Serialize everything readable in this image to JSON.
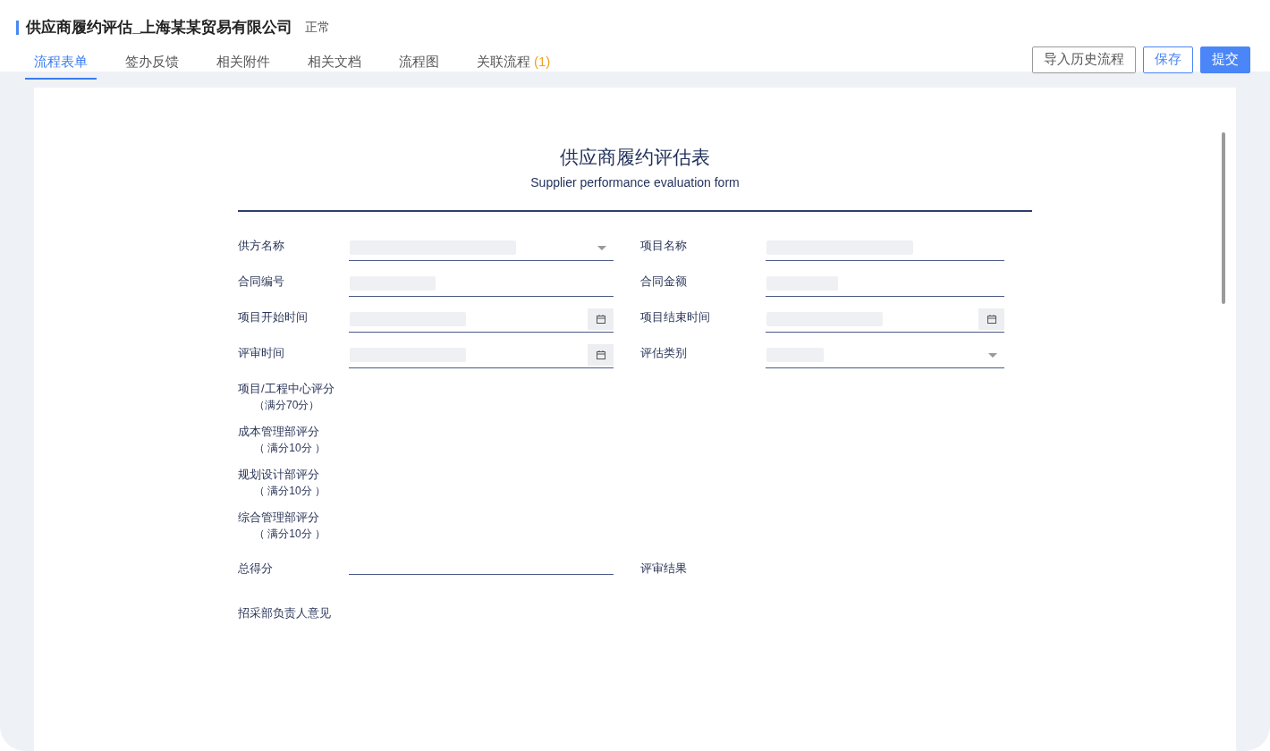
{
  "header": {
    "title": "供应商履约评估_上海某某贸易有限公司",
    "status": "正常"
  },
  "tabs": [
    {
      "label": "流程表单",
      "selected": true
    },
    {
      "label": "签办反馈",
      "selected": false
    },
    {
      "label": "相关附件",
      "selected": false
    },
    {
      "label": "相关文档",
      "selected": false
    },
    {
      "label": "流程图",
      "selected": false
    },
    {
      "label": "关联流程",
      "count": "(1)",
      "selected": false
    }
  ],
  "actions": [
    {
      "label": "导入历史流程",
      "kind": "default"
    },
    {
      "label": "保存",
      "kind": "outline"
    },
    {
      "label": "提交",
      "kind": "primary"
    }
  ],
  "form": {
    "title": "供应商履约评估表",
    "subtitle": "Supplier performance evaluation form",
    "fields": [
      {
        "label": "供方名称",
        "kind": "select"
      },
      {
        "label": "项目名称",
        "kind": "text"
      },
      {
        "label": "合同编号",
        "kind": "text"
      },
      {
        "label": "合同金额",
        "kind": "text"
      },
      {
        "label": "项目开始时间",
        "kind": "date"
      },
      {
        "label": "项目结束时间",
        "kind": "date"
      },
      {
        "label": "评审时间",
        "kind": "date"
      },
      {
        "label": "评估类别",
        "kind": "select"
      }
    ],
    "scores": [
      {
        "label": "项目/工程中心评分",
        "note": "（满分70分）"
      },
      {
        "label": "成本管理部评分",
        "note": "（ 满分10分 ）"
      },
      {
        "label": "规划设计部评分",
        "note": "（ 满分10分 ）"
      },
      {
        "label": "综合管理部评分",
        "note": "（ 满分10分 ）"
      }
    ],
    "total": {
      "label": "总得分"
    },
    "result": {
      "label": "评审结果"
    },
    "opinion": {
      "label": "招采部负责人意见"
    }
  }
}
